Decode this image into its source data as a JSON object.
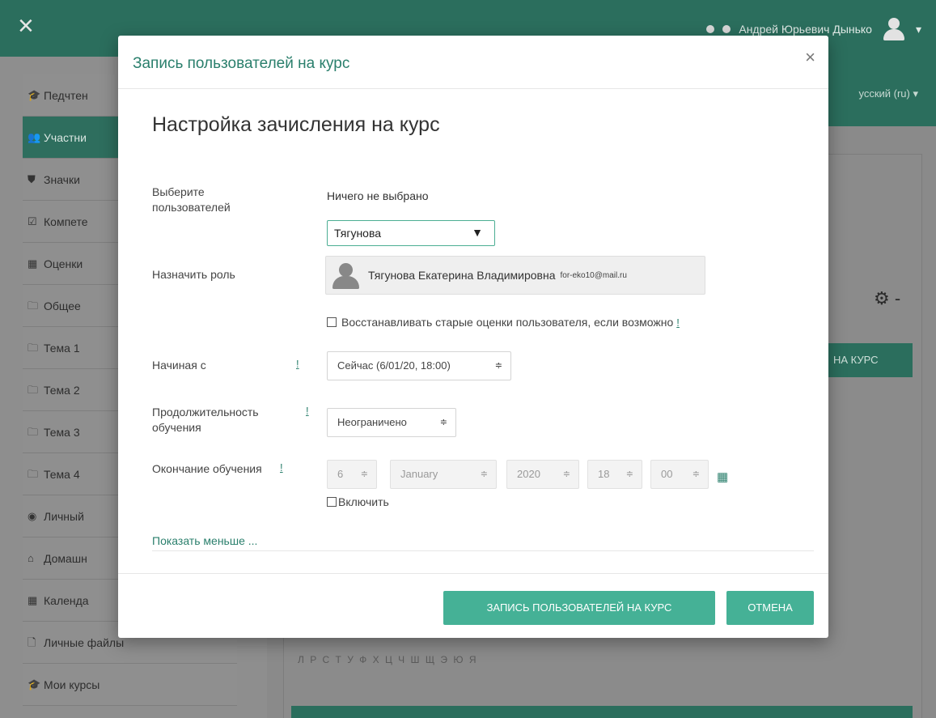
{
  "topbar": {
    "close_glyph": "×",
    "user_name": "Андрей Юрьевич Дынько"
  },
  "sidebar": {
    "items": [
      {
        "label": "Педчтен",
        "icon": "graduation-cap-icon",
        "glyph": "🎓"
      },
      {
        "label": "Участни",
        "icon": "users-icon",
        "glyph": "👥"
      },
      {
        "label": "Значки",
        "icon": "shield-icon",
        "glyph": "⛊"
      },
      {
        "label": "Компете",
        "icon": "checkbox-icon",
        "glyph": "☑"
      },
      {
        "label": "Оценки",
        "icon": "table-icon",
        "glyph": "▦"
      },
      {
        "label": "Общее",
        "icon": "folder-icon",
        "glyph": "🗀"
      },
      {
        "label": "Тема 1",
        "icon": "folder-icon",
        "glyph": "🗀"
      },
      {
        "label": "Тема 2",
        "icon": "folder-icon",
        "glyph": "🗀"
      },
      {
        "label": "Тема 3",
        "icon": "folder-icon",
        "glyph": "🗀"
      },
      {
        "label": "Тема 4",
        "icon": "folder-icon",
        "glyph": "🗀"
      },
      {
        "label": "Личный",
        "icon": "dashboard-icon",
        "glyph": "◉"
      },
      {
        "label": "Домашн",
        "icon": "home-icon",
        "glyph": "⌂"
      },
      {
        "label": "Календа",
        "icon": "calendar-icon",
        "glyph": "▦"
      },
      {
        "label": "Личные файлы",
        "icon": "file-icon",
        "glyph": "🗋"
      },
      {
        "label": "Мои курсы",
        "icon": "graduation-cap-icon",
        "glyph": "🎓"
      }
    ]
  },
  "background": {
    "language": "усский (ru) ▾",
    "enrol_button": "НА КУРС",
    "alphabet": "Л Р С Т У Ф Х Ц Ч Ш Щ Э Ю Я"
  },
  "modal": {
    "title": "Запись пользователей на курс",
    "close_glyph": "×",
    "section_heading": "Настройка зачисления на курс",
    "select_users_label": "Выберите пользователей",
    "nothing_selected": "Ничего не выбрано",
    "user_search_value": "Тягунова",
    "suggestion_name": "Тягунова Екатерина Владимировна",
    "suggestion_email": "for-eko10@mail.ru",
    "assign_role_label": "Назначить роль",
    "recover_grades_label": "Восстанавливать старые оценки пользователя, если возможно",
    "help_glyph": "!",
    "starting_from_label": "Начиная с",
    "starting_from_value": "Сейчас (6/01/20, 18:00)",
    "duration_label": "Продолжительность обучения",
    "duration_value": "Неограничено",
    "enrol_end_label": "Окончание обучения",
    "end_day": "6",
    "end_month": "January",
    "end_year": "2020",
    "end_hour": "18",
    "end_minute": "00",
    "enable_label": "Включить",
    "show_less": "Показать меньше ...",
    "submit_button": "ЗАПИСЬ ПОЛЬЗОВАТЕЛЕЙ НА КУРС",
    "cancel_button": "ОТМЕНА",
    "caret_glyph": "≑",
    "calendar_glyph": "▦"
  },
  "colors": {
    "brand_green": "#2b6e5d",
    "button_green": "#45b196",
    "link_green": "#2a7f6c"
  }
}
